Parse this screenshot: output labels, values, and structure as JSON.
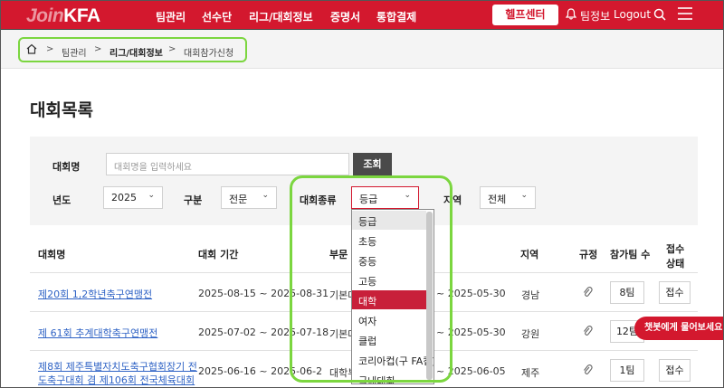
{
  "header": {
    "logo": {
      "prefix": "Join",
      "brand": "KFA"
    },
    "nav": [
      "팀관리",
      "선수단",
      "리그/대회정보",
      "증명서",
      "통합결제"
    ],
    "help_label": "헬프센터",
    "team_info_label": "팀정보",
    "logout_label": "Logout",
    "accent_color": "#d3182e"
  },
  "breadcrumb": {
    "items": [
      "팀관리",
      "리그/대회정보",
      "대회참가신청"
    ]
  },
  "page_title": "대회목록",
  "search": {
    "name_label": "대회명",
    "name_placeholder": "대회명을 입력하세요",
    "search_button": "조회",
    "year_label": "년도",
    "year_value": "2025",
    "division_label": "구분",
    "division_value": "전문",
    "type_label": "대회종류",
    "type_value": "등급",
    "region_label": "지역",
    "region_value": "전체"
  },
  "table": {
    "headers": [
      "대회명",
      "대회 기간",
      "부문",
      "지역",
      "규정",
      "참가팀 수",
      "접수",
      "상태"
    ],
    "rows": [
      {
        "name": "제20회 1,2학년축구연맹전",
        "period": "2025-08-15 ~ 2025-08-31",
        "category": "기본대",
        "reg_end": "~ 2025-05-30",
        "region": "경남",
        "teams": "8팀",
        "status": "접수"
      },
      {
        "name": "제 61회 추계대학축구연맹전",
        "period": "2025-07-02 ~ 2025-07-18",
        "category": "기본대",
        "reg_end": "~ 2025-05-30",
        "region": "강원",
        "teams": "12팀",
        "status": "접수"
      },
      {
        "name_line1": "제8회 제주특별자치도축구협회장기 전",
        "name_line2": "도축구대회 겸 제106회 전국체육대회",
        "period": "2025-06-16 ~ 2025-06-2",
        "category": "대학부",
        "reg_end": "~ 2025-06-05",
        "region": "제주",
        "teams": "1팀",
        "status": "접수"
      }
    ]
  },
  "dropdown": {
    "options": [
      "등급",
      "초등",
      "중등",
      "고등",
      "대학",
      "여자",
      "클럽",
      "코리아컵(구 FA컵)",
      "국내대회"
    ],
    "hovered": "등급",
    "selected": "대학"
  },
  "chat_button": "챗봇에게 물어보세요"
}
